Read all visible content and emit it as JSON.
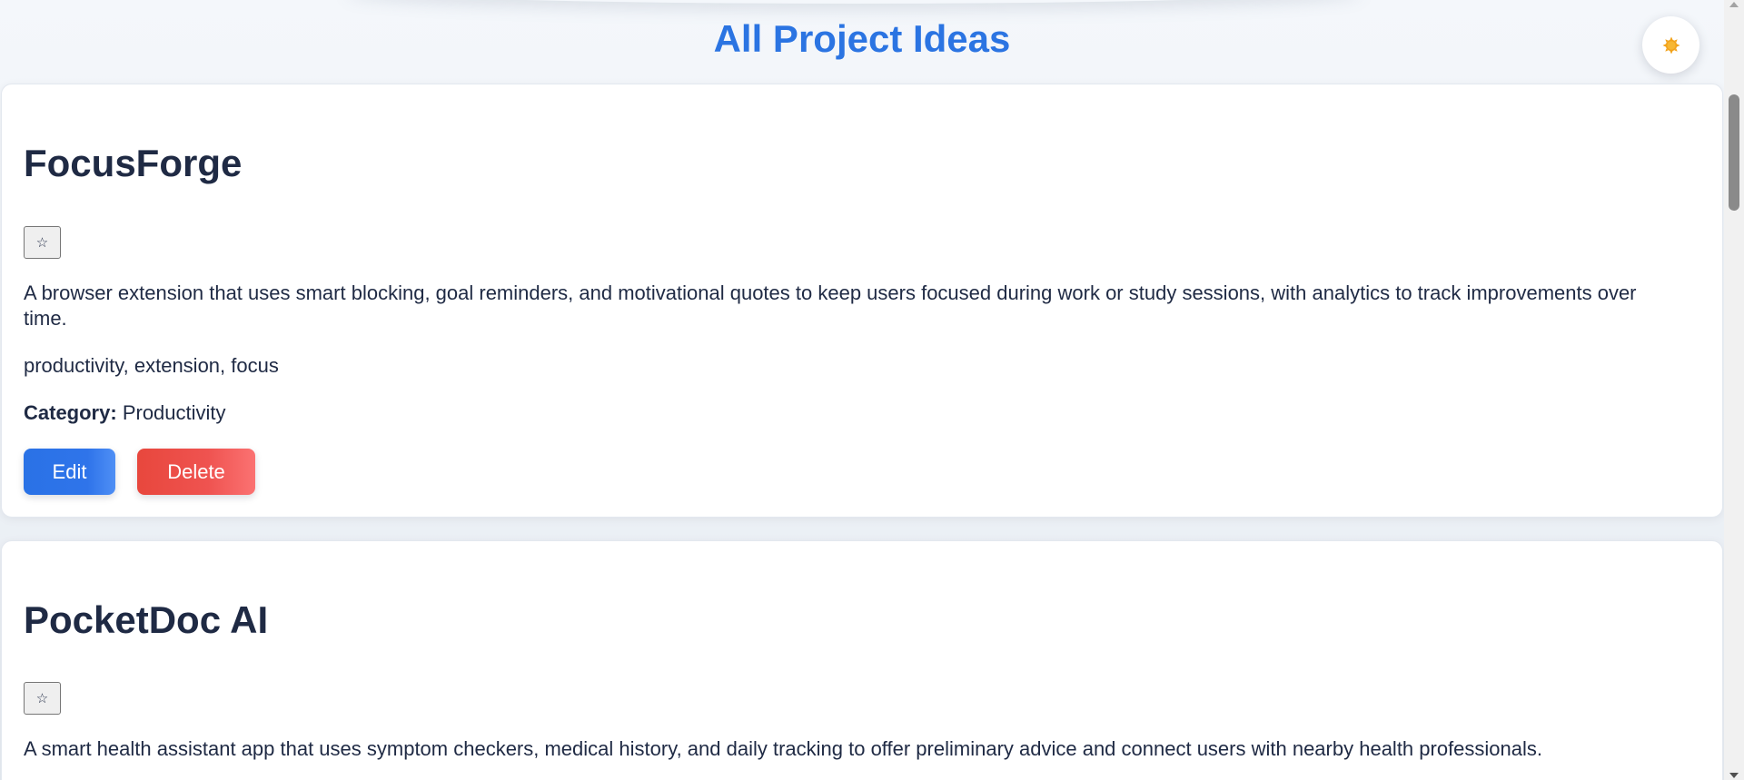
{
  "page": {
    "title": "All Project Ideas"
  },
  "theme_toggle": {
    "icon": "sun-icon",
    "sun_color": "#f5a623"
  },
  "ideas": [
    {
      "name": "FocusForge",
      "favorite_symbol": "☆",
      "description": "A browser extension that uses smart blocking, goal reminders, and motivational quotes to keep users focused during work or study sessions, with analytics to track improvements over time.",
      "tags": "productivity, extension, focus",
      "category_label": "Category:",
      "category": "Productivity",
      "edit_label": "Edit",
      "delete_label": "Delete"
    },
    {
      "name": "PocketDoc AI",
      "favorite_symbol": "☆",
      "description": "A smart health assistant app that uses symptom checkers, medical history, and daily tracking to offer preliminary advice and connect users with nearby health professionals."
    }
  ],
  "colors": {
    "accent": "#2b74e2",
    "danger": "#ef5350",
    "text": "#1f2a44"
  }
}
